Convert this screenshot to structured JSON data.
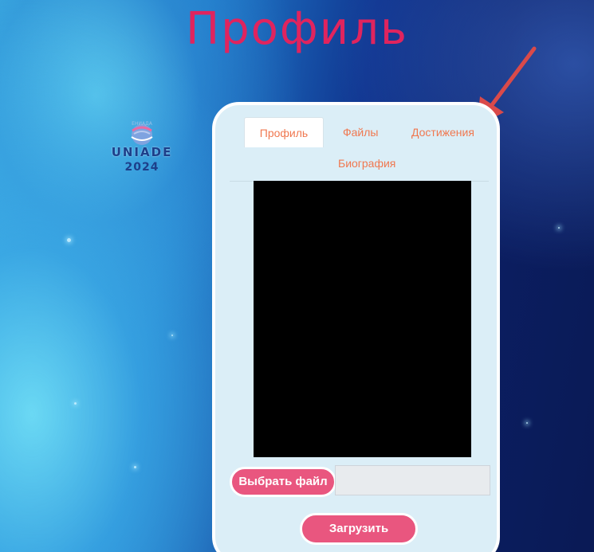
{
  "page": {
    "title": "Профиль"
  },
  "logo": {
    "top_text": "ЕНИАДА",
    "name": "UNIADE",
    "year": "2024"
  },
  "tabs": [
    {
      "label": "Профиль",
      "active": true
    },
    {
      "label": "Файлы",
      "active": false
    },
    {
      "label": "Достижения",
      "active": false
    },
    {
      "label": "Биография",
      "active": false
    }
  ],
  "upload": {
    "choose_label": "Выбрать файл",
    "file_value": "",
    "submit_label": "Загрузить"
  },
  "colors": {
    "title": "#e0245e",
    "tab_text": "#f07850",
    "button": "#e9567f",
    "card_bg": "#dbeef7",
    "arrow": "#d94a4a"
  }
}
